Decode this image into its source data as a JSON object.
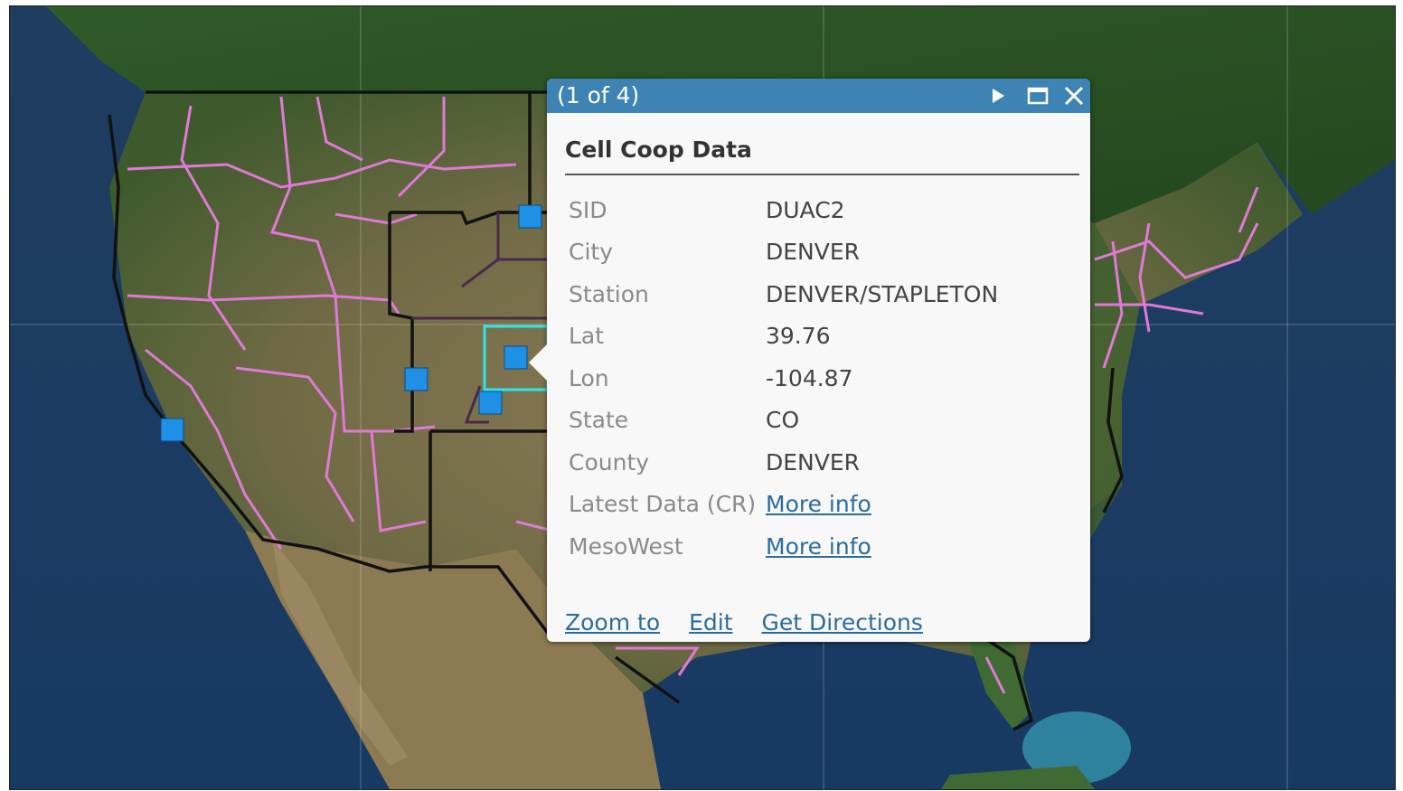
{
  "popup": {
    "counter": "(1 of 4)",
    "title": "Cell Coop Data",
    "attributes": [
      {
        "label": "SID",
        "value": "DUAC2",
        "is_link": false
      },
      {
        "label": "City",
        "value": "DENVER",
        "is_link": false
      },
      {
        "label": "Station",
        "value": "DENVER/STAPLETON",
        "is_link": false
      },
      {
        "label": "Lat",
        "value": "39.76",
        "is_link": false
      },
      {
        "label": "Lon",
        "value": "-104.87",
        "is_link": false
      },
      {
        "label": "State",
        "value": "CO",
        "is_link": false
      },
      {
        "label": "County",
        "value": "DENVER",
        "is_link": false
      },
      {
        "label": "Latest Data (CR)",
        "value": "More info",
        "is_link": true
      },
      {
        "label": "MesoWest",
        "value": "More info",
        "is_link": true
      }
    ],
    "actions": {
      "zoom_to": "Zoom to",
      "edit": "Edit",
      "get_directions": "Get Directions"
    },
    "header_icons": [
      "next-feature-icon",
      "maximize-icon",
      "close-icon"
    ]
  },
  "colors": {
    "header": "#3d83b4",
    "link": "#2b6c9e",
    "county_boundary": "#e07ad6",
    "state_boundary": "#111111",
    "station_marker": "#1e90e6",
    "selected_highlight": "#2ee6e6"
  }
}
